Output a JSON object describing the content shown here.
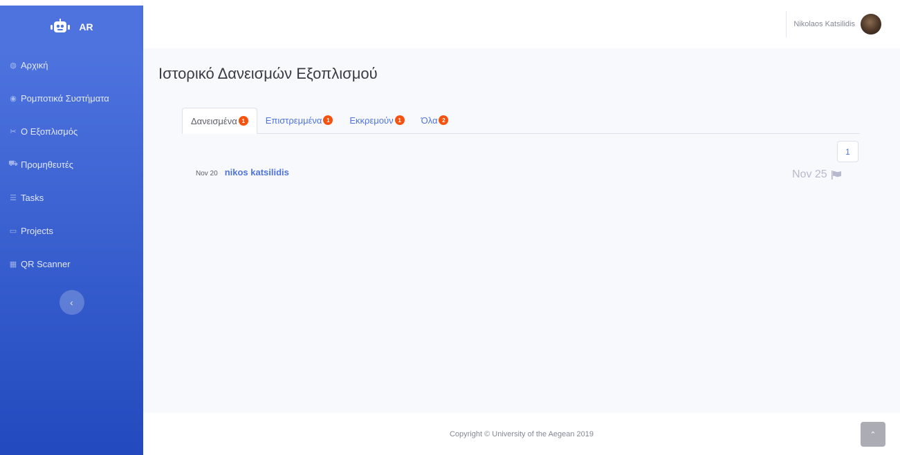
{
  "brand": {
    "name": "AR",
    "logo_icon": "robot-icon"
  },
  "sidebar": {
    "items": [
      {
        "icon": "dashboard-icon",
        "glyph": "◍",
        "label": "Αρχική"
      },
      {
        "icon": "robot-icon",
        "glyph": "◉",
        "label": "Ρομποτικά Συστήματα"
      },
      {
        "icon": "tools-icon",
        "glyph": "✂",
        "label": "Ο Εξοπλισμός"
      },
      {
        "icon": "cart-icon",
        "glyph": "⛟",
        "label": "Προμηθευτές"
      },
      {
        "icon": "list-icon",
        "glyph": "☰",
        "label": "Tasks"
      },
      {
        "icon": "folder-icon",
        "glyph": "▭",
        "label": "Projects"
      },
      {
        "icon": "qrcode-icon",
        "glyph": "▦",
        "label": "QR Scanner"
      }
    ],
    "toggle_glyph": "‹"
  },
  "topbar": {
    "user_name": "Nikolaos Katsilidis"
  },
  "page": {
    "title": "Ιστορικό Δανεισμών Εξοπλισμού"
  },
  "tabs": [
    {
      "label": "Δανεισμένα",
      "count": "1",
      "active": true
    },
    {
      "label": "Επιστρεμμένα",
      "count": "1",
      "active": false
    },
    {
      "label": "Εκκρεμούν",
      "count": "1",
      "active": false
    },
    {
      "label": "Όλα",
      "count": "2",
      "active": false
    }
  ],
  "pagination": {
    "current": "1"
  },
  "loans": [
    {
      "date": "Nov 20",
      "name": "nikos katsilidis",
      "due": "Nov 25",
      "due_icon": "flag-icon"
    }
  ],
  "footer": {
    "copyright": "Copyright © University of the Aegean 2019"
  },
  "scroll_top": {
    "glyph": "⌃"
  },
  "colors": {
    "sidebar_top": "#4e73df",
    "sidebar_bottom": "#224abe",
    "accent": "#4e73df",
    "badge": "#f6520f",
    "content_bg": "#f8f9fc"
  }
}
